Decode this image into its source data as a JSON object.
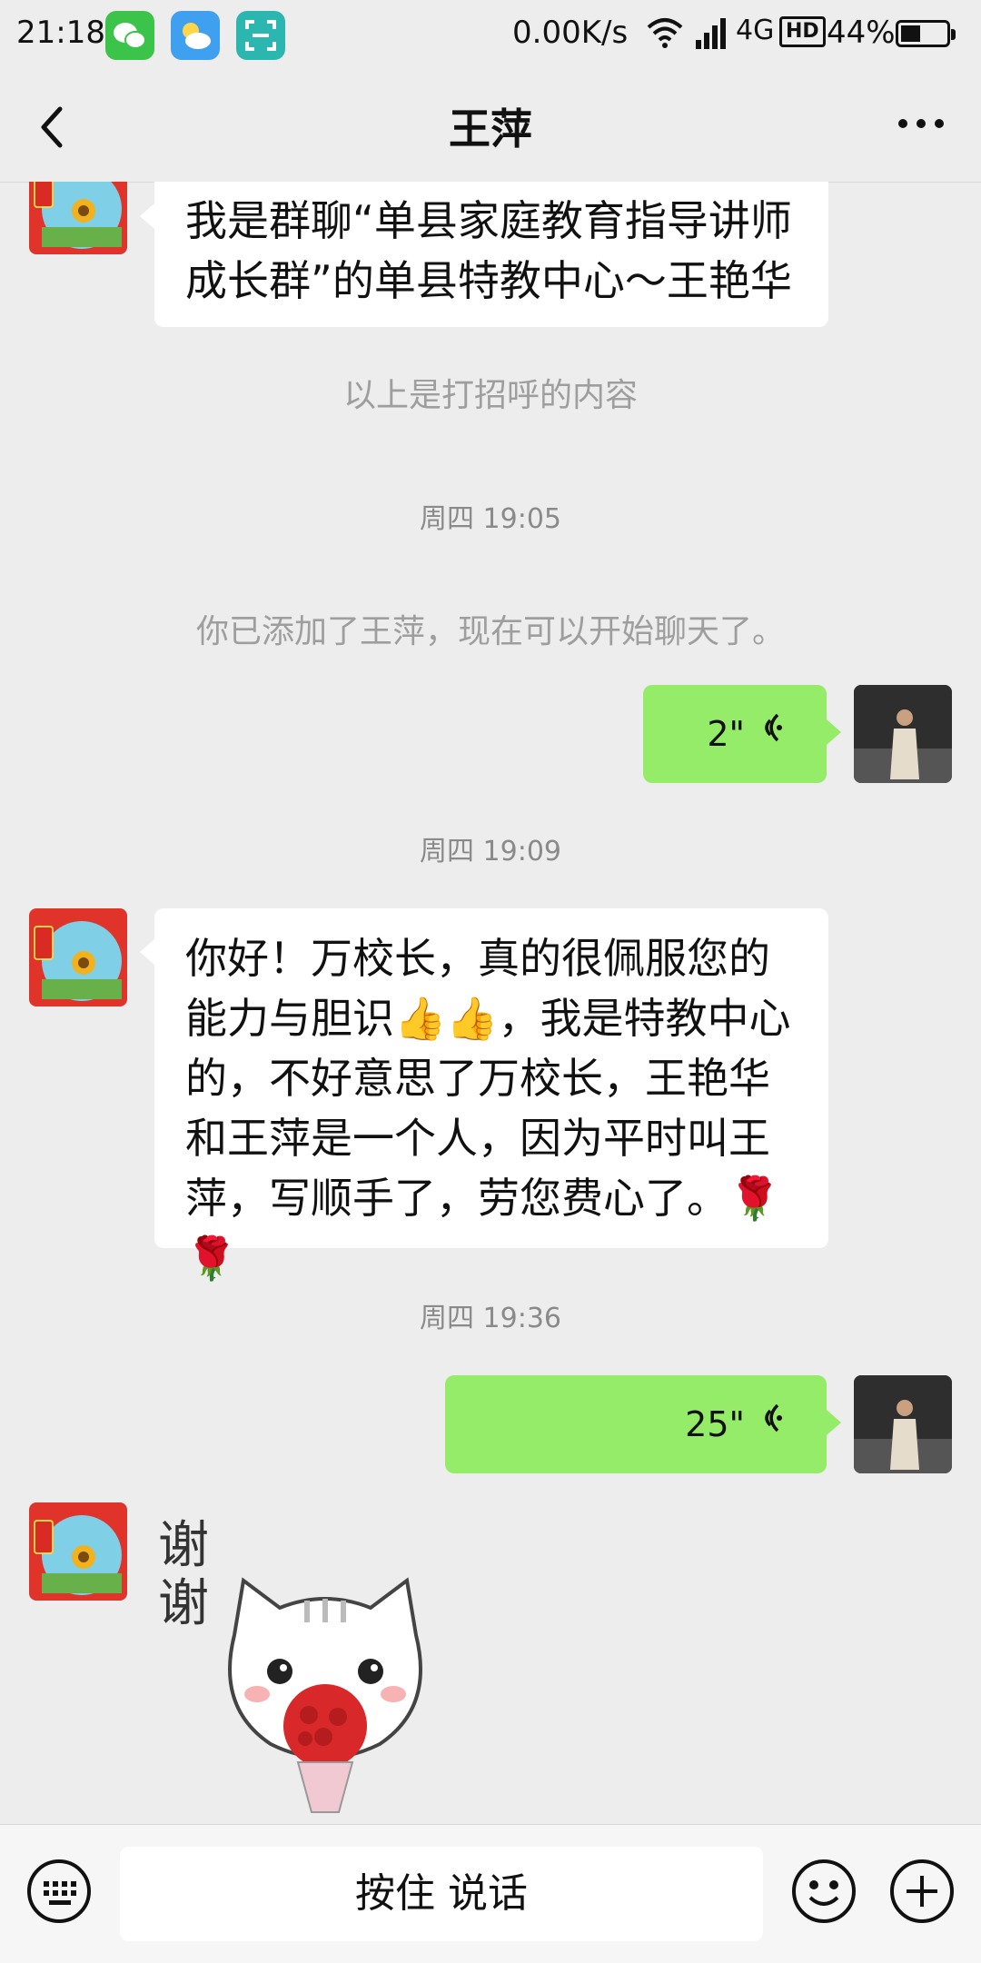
{
  "status": {
    "time": "21:18",
    "network_speed": "0.00K/s",
    "network_type": "4G",
    "hd": "HD",
    "battery": "44%",
    "battery_level": 0.44
  },
  "header": {
    "title": "王萍"
  },
  "messages": {
    "greeting_text": "我是群聊“单县家庭教育指导讲师成长群”的单县特教中心～王艳华",
    "greeting_note": "以上是打招呼的内容",
    "ts1": "周四 19:05",
    "added_note": "你已添加了王萍，现在可以开始聊天了。",
    "voice1_duration": "2\"",
    "ts2": "周四 19:09",
    "long_text": "你好！万校长，真的很佩服您的能力与胆识👍👍，我是特教中心的，不好意思了万校长，王艳华和王萍是一个人，因为平时叫王萍，写顺手了，劳您费心了。🌹🌹",
    "ts3": "周四 19:36",
    "voice2_duration": "25\"",
    "sticker_text": "谢谢"
  },
  "input": {
    "talk_label": "按住 说话"
  },
  "colors": {
    "background": "#ededed",
    "my_bubble": "#95ec69",
    "their_bubble": "#ffffff",
    "system_text": "#9e9e9e"
  }
}
